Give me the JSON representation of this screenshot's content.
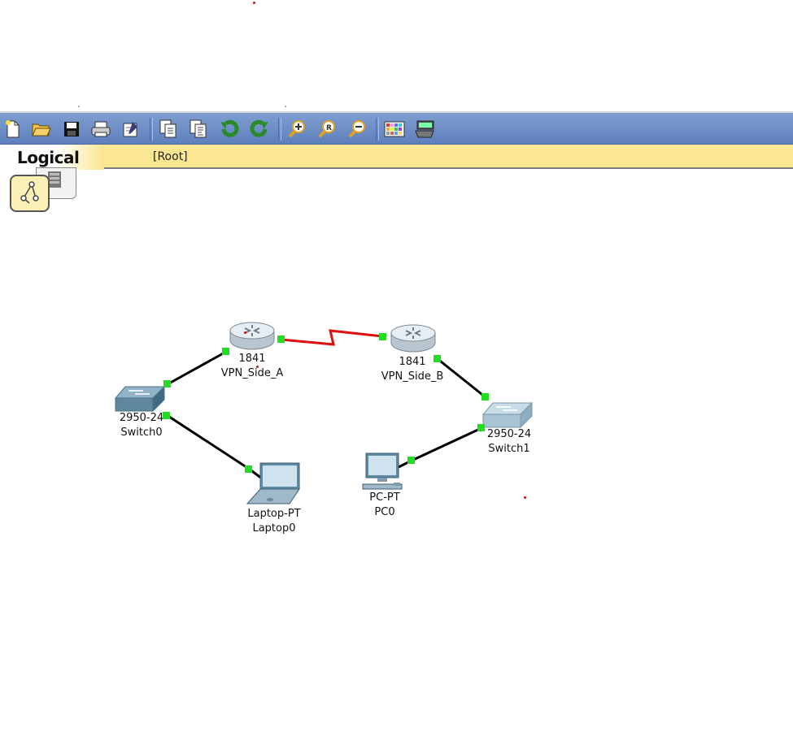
{
  "colors": {
    "toolbar_bg": "#6b8cc7",
    "workspace_bar_bg": "#fbe691",
    "link_serial": "#e01010",
    "link_ethernet": "#000000",
    "port_up": "#22dd22"
  },
  "toolbar": {
    "buttons": [
      {
        "icon": "new-file-icon"
      },
      {
        "icon": "open-folder-icon"
      },
      {
        "icon": "save-icon"
      },
      {
        "icon": "print-icon"
      },
      {
        "icon": "activity-wizard-icon"
      },
      {
        "icon": "copy-icon"
      },
      {
        "icon": "paste-icon"
      },
      {
        "icon": "undo-icon"
      },
      {
        "icon": "redo-icon"
      },
      {
        "icon": "zoom-in-icon"
      },
      {
        "icon": "zoom-reset-icon"
      },
      {
        "icon": "zoom-out-icon"
      },
      {
        "icon": "palette-icon"
      },
      {
        "icon": "custom-device-icon"
      }
    ]
  },
  "workspace": {
    "tab_label": "Logical",
    "breadcrumb": "[Root]"
  },
  "devices": {
    "router_a": {
      "model": "1841",
      "name": "VPN_Side_A"
    },
    "router_b": {
      "model": "1841",
      "name": "VPN_Side_B"
    },
    "switch0": {
      "model": "2950-24",
      "name": "Switch0"
    },
    "switch1": {
      "model": "2950-24",
      "name": "Switch1"
    },
    "laptop0": {
      "model": "Laptop-PT",
      "name": "Laptop0"
    },
    "pc0": {
      "model": "PC-PT",
      "name": "PC0"
    }
  }
}
